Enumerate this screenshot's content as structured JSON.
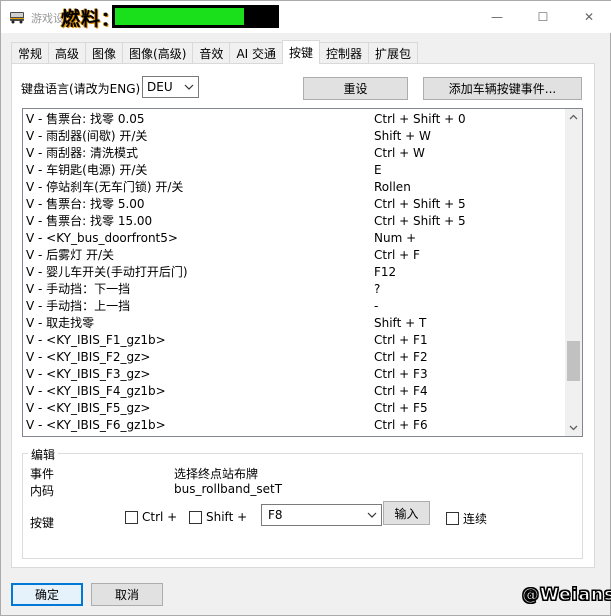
{
  "title_bar": {
    "app_title": "游戏设",
    "fuel_label": "燃料：",
    "fuel_level_percent": 80,
    "fuel_color": "#19e01a",
    "minimize_glyph": "—",
    "maximize_glyph": "☐",
    "close_glyph": "✕"
  },
  "tabs": [
    "常规",
    "高级",
    "图像",
    "图像(高级)",
    "音效",
    "AI 交通",
    "按键",
    "控制器",
    "扩展包"
  ],
  "active_tab": "按键",
  "keyboard": {
    "language_label": "键盘语言(请改为ENG)",
    "language_value": "DEU",
    "reset_button": "重设",
    "add_event_button": "添加车辆按键事件..."
  },
  "key_list": {
    "rows": [
      {
        "name": "V - 售票台: 找零 0.05",
        "key": "Ctrl + Shift + 0"
      },
      {
        "name": "V - 雨刮器(间歇) 开/关",
        "key": "Shift + W"
      },
      {
        "name": "V - 雨刮器: 清洗模式",
        "key": "Ctrl + W"
      },
      {
        "name": "V - 车钥匙(电源) 开/关",
        "key": "E"
      },
      {
        "name": "V - 停站刹车(无车门锁) 开/关",
        "key": "Rollen"
      },
      {
        "name": "V - 售票台: 找零 5.00",
        "key": "Ctrl + Shift + 5"
      },
      {
        "name": "V - 售票台: 找零 15.00",
        "key": "Ctrl + Shift + 5"
      },
      {
        "name": "V - <KY_bus_doorfront5>",
        "key": "Num +"
      },
      {
        "name": "V - 后雾灯 开/关",
        "key": "Ctrl + F"
      },
      {
        "name": "V - 婴儿车开关(手动打开后门)",
        "key": "F12"
      },
      {
        "name": "V - 手动挡：下一挡",
        "key": "?"
      },
      {
        "name": "V - 手动挡：上一挡",
        "key": "-"
      },
      {
        "name": "V - 取走找零",
        "key": "Shift + T"
      },
      {
        "name": "V - <KY_IBIS_F1_gz1b>",
        "key": "Ctrl + F1"
      },
      {
        "name": "V - <KY_IBIS_F2_gz>",
        "key": "Ctrl + F2"
      },
      {
        "name": "V - <KY_IBIS_F3_gz>",
        "key": "Ctrl + F3"
      },
      {
        "name": "V - <KY_IBIS_F4_gz1b>",
        "key": "Ctrl + F4"
      },
      {
        "name": "V - <KY_IBIS_F5_gz>",
        "key": "Ctrl + F5"
      },
      {
        "name": "V - <KY_IBIS_F6_gz1b>",
        "key": "Ctrl + F6"
      }
    ],
    "scroll_position": 0.85
  },
  "edit": {
    "group_title": "编辑",
    "event_label": "事件",
    "event_value": "选择终点站布牌",
    "code_label": "内码",
    "code_value": "bus_rollband_setT",
    "key_label": "按键",
    "ctrl_label": "Ctrl +",
    "shift_label": "Shift +",
    "key_value": "F8",
    "input_button": "输入",
    "repeat_label": "连续"
  },
  "footer": {
    "ok_button": "确定",
    "cancel_button": "取消",
    "watermark": "@Weians"
  }
}
